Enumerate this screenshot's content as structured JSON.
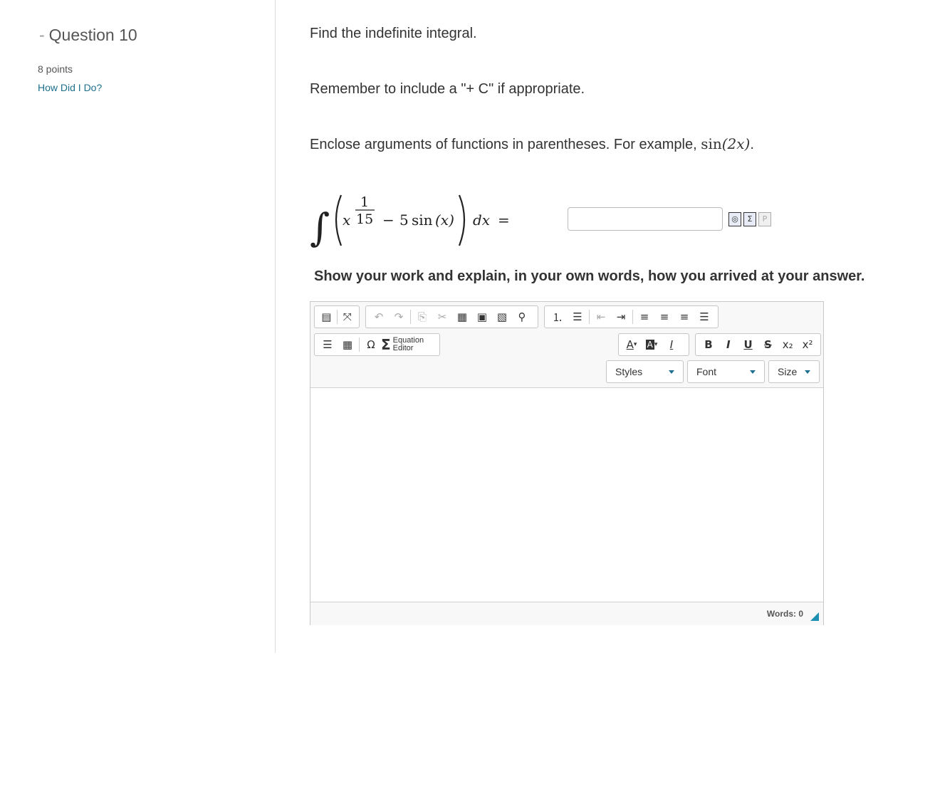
{
  "sidebar": {
    "dash": "-",
    "question_title": "Question 10",
    "points": "8 points",
    "how_did_link": "How Did I Do?"
  },
  "prompt": {
    "line1": "Find the indefinite integral.",
    "line2": "Remember to include a \"+ C\" if appropriate.",
    "line3": "Enclose arguments of functions in parentheses. For example,",
    "example_fn": "sin",
    "example_arg": "(2x)",
    "example_end": "."
  },
  "integral": {
    "integral_sign": "∫",
    "base": "x",
    "exp_num": "1",
    "exp_den": "15",
    "minus": "−",
    "coef": "5",
    "fn": "sin",
    "arg": "(x)",
    "dx": "dx",
    "equals": "="
  },
  "answer": {
    "value": "",
    "placeholder": ""
  },
  "answer_tools": [
    "preview-icon",
    "equation-icon",
    "page-icon"
  ],
  "instructions": "Show your work and explain, in your own words, how you arrived at your answer.",
  "editor": {
    "equation_editor_line1": "Equation",
    "equation_editor_line2": "Editor",
    "styles_label": "Styles",
    "font_label": "Font",
    "size_label": "Size",
    "bold": "B",
    "italic": "I",
    "underline": "U",
    "strike": "S",
    "omega": "Ω",
    "sigma": "Σ",
    "words_count": "Words: 0",
    "accent_color": "#1d8fb3"
  }
}
